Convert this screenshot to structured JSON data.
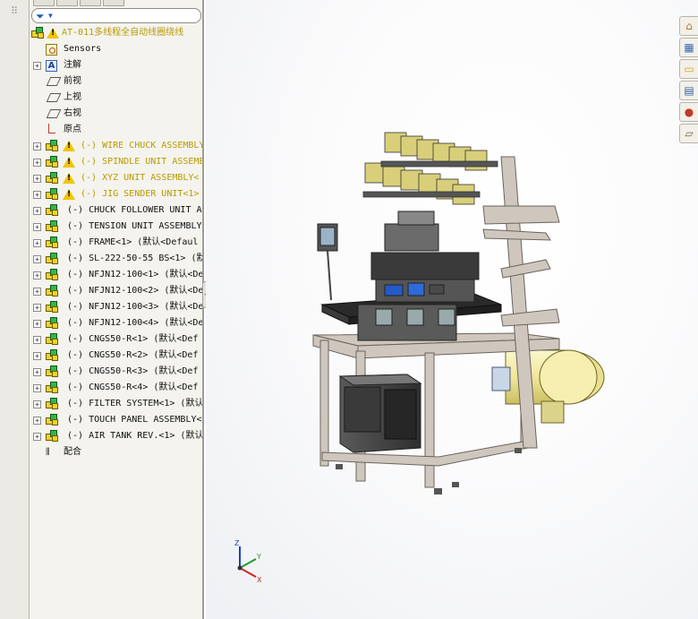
{
  "feature_tree": {
    "filter_icon": "funnel-icon",
    "tabs": [
      "feature-manager-tab",
      "property-manager-tab",
      "configuration-manager-tab",
      "display-manager-tab"
    ],
    "root": {
      "label": "AT-011多线程全自动线圈绕线",
      "icon": "assembly-warning-icon"
    },
    "items": [
      {
        "label": "Sensors",
        "icon": "sensor-icon",
        "expandable": false
      },
      {
        "label": "注解",
        "icon": "annotation-icon",
        "expandable": true
      },
      {
        "label": "前视",
        "icon": "plane-icon",
        "expandable": false
      },
      {
        "label": "上视",
        "icon": "plane-icon",
        "expandable": false
      },
      {
        "label": "右视",
        "icon": "plane-icon",
        "expandable": false
      },
      {
        "label": "原点",
        "icon": "origin-icon",
        "expandable": false
      },
      {
        "label": "(-) WIRE CHUCK ASSEMBLY",
        "icon": "subassembly-icon",
        "warning": true,
        "expandable": true
      },
      {
        "label": "(-) SPINDLE UNIT ASSEMBLE",
        "icon": "subassembly-icon",
        "warning": true,
        "expandable": true
      },
      {
        "label": "(-) XYZ  UNIT ASSEMBLY<",
        "icon": "subassembly-icon",
        "warning": true,
        "expandable": true
      },
      {
        "label": "(-) JIG SENDER UNIT<1>",
        "icon": "subassembly-icon",
        "warning": true,
        "expandable": true
      },
      {
        "label": "(-) CHUCK FOLLOWER UNIT AS",
        "icon": "subassembly-icon",
        "warning": false,
        "expandable": true
      },
      {
        "label": "(-) TENSION UNIT ASSEMBLY",
        "icon": "subassembly-icon",
        "warning": false,
        "expandable": true
      },
      {
        "label": "(-) FRAME<1> (默认<Defaul",
        "icon": "subassembly-icon",
        "warning": false,
        "expandable": true
      },
      {
        "label": "(-) SL-222-50-55 BS<1> (默",
        "icon": "subassembly-icon",
        "warning": false,
        "expandable": true
      },
      {
        "label": "(-) NFJN12-100<1> (默认<De",
        "icon": "subassembly-icon",
        "warning": false,
        "expandable": true
      },
      {
        "label": "(-) NFJN12-100<2> (默认<De",
        "icon": "subassembly-icon",
        "warning": false,
        "expandable": true
      },
      {
        "label": "(-) NFJN12-100<3> (默认<De",
        "icon": "subassembly-icon",
        "warning": false,
        "expandable": true
      },
      {
        "label": "(-) NFJN12-100<4> (默认<De",
        "icon": "subassembly-icon",
        "warning": false,
        "expandable": true
      },
      {
        "label": "(-) CNGS50-R<1> (默认<Def",
        "icon": "subassembly-icon",
        "warning": false,
        "expandable": true
      },
      {
        "label": "(-) CNGS50-R<2> (默认<Def",
        "icon": "subassembly-icon",
        "warning": false,
        "expandable": true
      },
      {
        "label": "(-) CNGS50-R<3> (默认<Def",
        "icon": "subassembly-icon",
        "warning": false,
        "expandable": true
      },
      {
        "label": "(-) CNGS50-R<4> (默认<Def",
        "icon": "subassembly-icon",
        "warning": false,
        "expandable": true
      },
      {
        "label": "(-) FILTER SYSTEM<1> (默认",
        "icon": "subassembly-icon",
        "warning": false,
        "expandable": true
      },
      {
        "label": "(-) TOUCH PANEL ASSEMBLY<",
        "icon": "subassembly-icon",
        "warning": false,
        "expandable": true
      },
      {
        "label": "(-) AIR TANK REV.<1> (默认",
        "icon": "subassembly-icon",
        "warning": false,
        "expandable": true
      },
      {
        "label": "配合",
        "icon": "mates-icon",
        "expandable": false
      }
    ]
  },
  "task_pane": {
    "buttons": [
      "home-icon",
      "design-library-icon",
      "file-explorer-icon",
      "view-palette-icon",
      "appearances-icon",
      "custom-properties-icon"
    ]
  },
  "triad": {
    "axes": [
      "Z",
      "Y",
      "X"
    ],
    "colors": {
      "z": "#1a3fd1",
      "y": "#1f9e2a",
      "x": "#d42020"
    }
  },
  "colors": {
    "warning_text": "#b89a00",
    "frame": "#c9c1b8",
    "tank": "#f3eca0",
    "cabinet": "#4a4a4a"
  }
}
